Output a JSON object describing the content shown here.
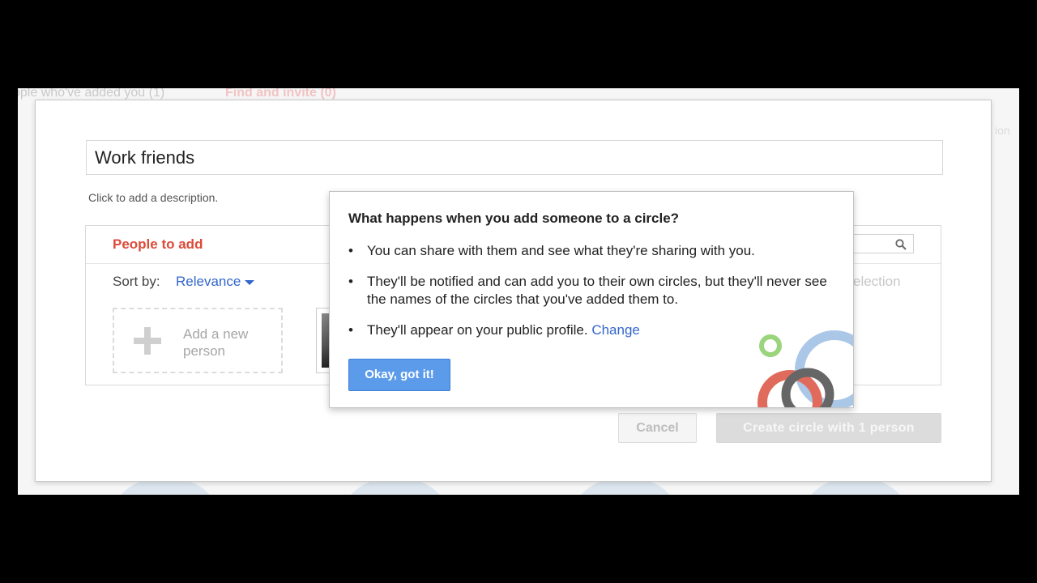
{
  "background": {
    "tabs": [
      "ople who've added you (1)",
      "Find and invite (0)"
    ],
    "right_text": "ion"
  },
  "modal": {
    "circle_name": "Work friends",
    "description_placeholder": "Click to add a description.",
    "people_tab": "People to add",
    "sort_label": "Sort by:",
    "sort_value": "Relevance",
    "add_person_label": "Add a new person",
    "selection_text": "election",
    "cancel_label": "Cancel",
    "create_label": "Create circle with 1 person"
  },
  "popup": {
    "title": "What happens when you add someone to a circle?",
    "bullets": [
      "You can share with them and see what they're sharing with you.",
      "They'll be notified and can add you to their own circles, but they'll never see the names of the circles that you've added them to.",
      "They'll appear on your public profile."
    ],
    "change_link": "Change",
    "ok_label": "Okay, got it!"
  },
  "colors": {
    "accent_red": "#dd4b39",
    "link_blue": "#3366cc",
    "button_blue": "#5b9bea",
    "circle_green": "#9ad47d",
    "circle_blue": "#aac7e8",
    "circle_red": "#e06b5d",
    "circle_dark": "#666666"
  },
  "icons": [
    "search-icon",
    "plus-icon",
    "caret-down-icon",
    "circles-logo-icon"
  ]
}
